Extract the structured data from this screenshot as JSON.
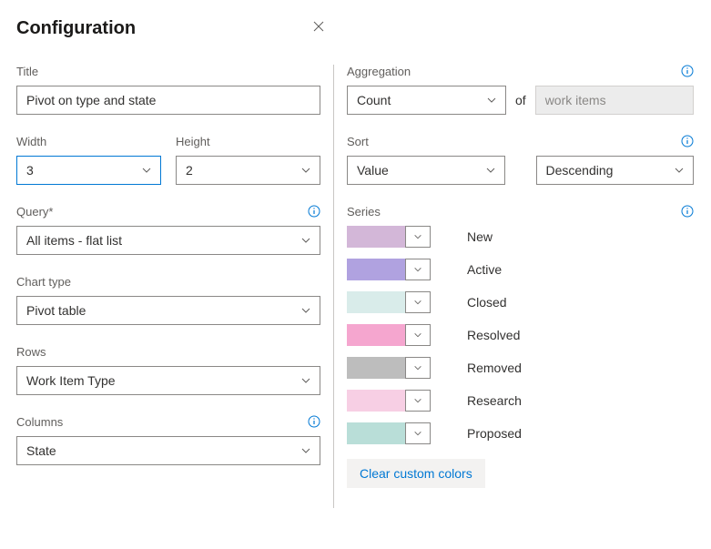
{
  "header": {
    "title": "Configuration"
  },
  "left": {
    "title_label": "Title",
    "title_value": "Pivot on type and state",
    "width_label": "Width",
    "width_value": "3",
    "height_label": "Height",
    "height_value": "2",
    "query_label": "Query*",
    "query_value": "All items - flat list",
    "chart_type_label": "Chart type",
    "chart_type_value": "Pivot table",
    "rows_label": "Rows",
    "rows_value": "Work Item Type",
    "columns_label": "Columns",
    "columns_value": "State"
  },
  "right": {
    "aggregation_label": "Aggregation",
    "aggregation_value": "Count",
    "aggregation_of": "of",
    "aggregation_target": "work items",
    "sort_label": "Sort",
    "sort_value": "Value",
    "sort_direction": "Descending",
    "series_label": "Series",
    "series": [
      {
        "label": "New",
        "color": "#d3b7d8"
      },
      {
        "label": "Active",
        "color": "#b0a2e0"
      },
      {
        "label": "Closed",
        "color": "#d9ecea"
      },
      {
        "label": "Resolved",
        "color": "#f5a6cf"
      },
      {
        "label": "Removed",
        "color": "#bdbdbd"
      },
      {
        "label": "Research",
        "color": "#f7cfe4"
      },
      {
        "label": "Proposed",
        "color": "#b9ded8"
      }
    ],
    "clear_colors": "Clear custom colors"
  }
}
